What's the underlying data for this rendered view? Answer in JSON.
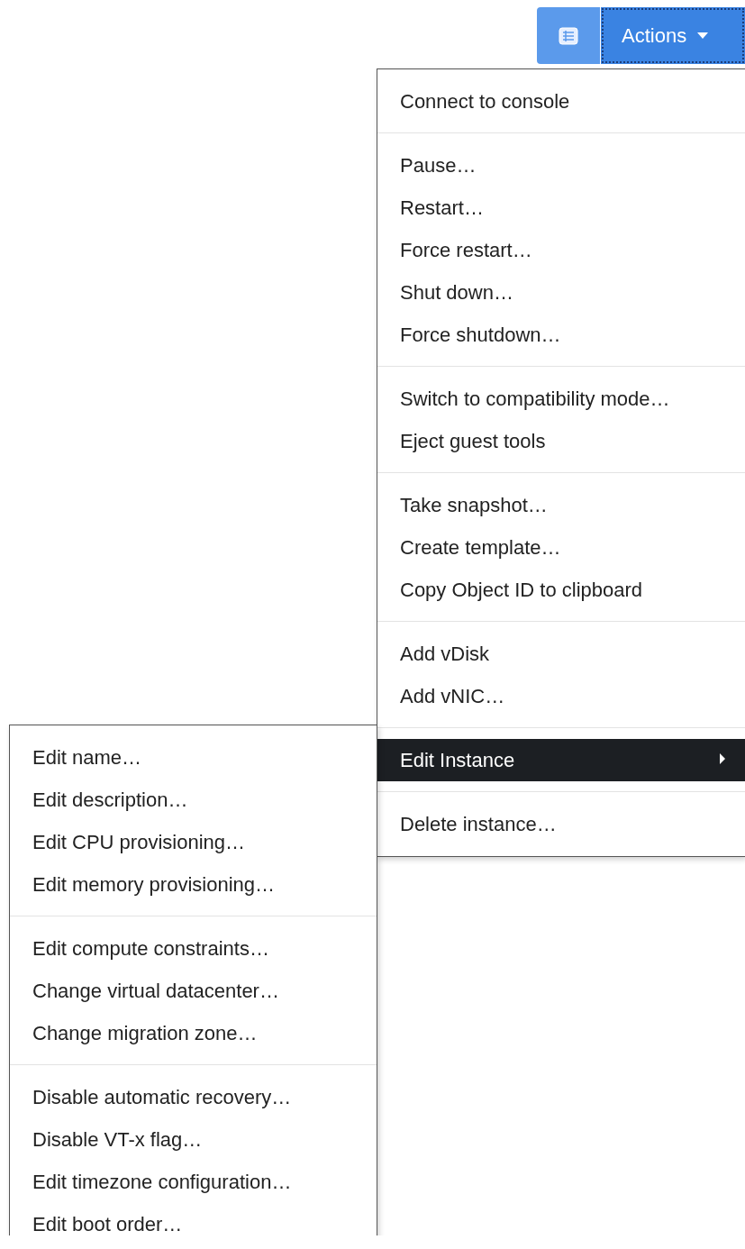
{
  "toolbar": {
    "actions_button": {
      "label": "Actions",
      "focused": true
    }
  },
  "actions_menu": {
    "groups": [
      [
        {
          "label": "Connect to console",
          "selected": false
        }
      ],
      [
        {
          "label": "Pause…",
          "selected": false
        },
        {
          "label": "Restart…",
          "selected": false
        },
        {
          "label": "Force restart…",
          "selected": false
        },
        {
          "label": "Shut down…",
          "selected": false
        },
        {
          "label": "Force shutdown…",
          "selected": false
        }
      ],
      [
        {
          "label": "Switch to compatibility mode…",
          "selected": false
        },
        {
          "label": "Eject guest tools",
          "selected": false
        }
      ],
      [
        {
          "label": "Take snapshot…",
          "selected": false
        },
        {
          "label": "Create template…",
          "selected": false
        },
        {
          "label": "Copy Object ID to clipboard",
          "selected": false
        }
      ],
      [
        {
          "label": "Add vDisk",
          "selected": false
        },
        {
          "label": "Add vNIC…",
          "selected": false
        }
      ],
      [
        {
          "label": "Edit Instance",
          "selected": true,
          "kind": "submenu",
          "expanded": true,
          "children": [
            [
              {
                "label": "Edit name…"
              },
              {
                "label": "Edit description…"
              },
              {
                "label": "Edit CPU provisioning…"
              },
              {
                "label": "Edit memory provisioning…"
              }
            ],
            [
              {
                "label": "Edit compute constraints…"
              },
              {
                "label": "Change virtual datacenter…"
              },
              {
                "label": "Change migration zone…"
              }
            ],
            [
              {
                "label": "Disable automatic recovery…"
              },
              {
                "label": "Disable VT-x flag…"
              },
              {
                "label": "Edit timezone configuration…"
              },
              {
                "label": "Edit boot order…"
              }
            ]
          ]
        }
      ],
      [
        {
          "label": "Delete instance…",
          "selected": false
        }
      ]
    ]
  }
}
